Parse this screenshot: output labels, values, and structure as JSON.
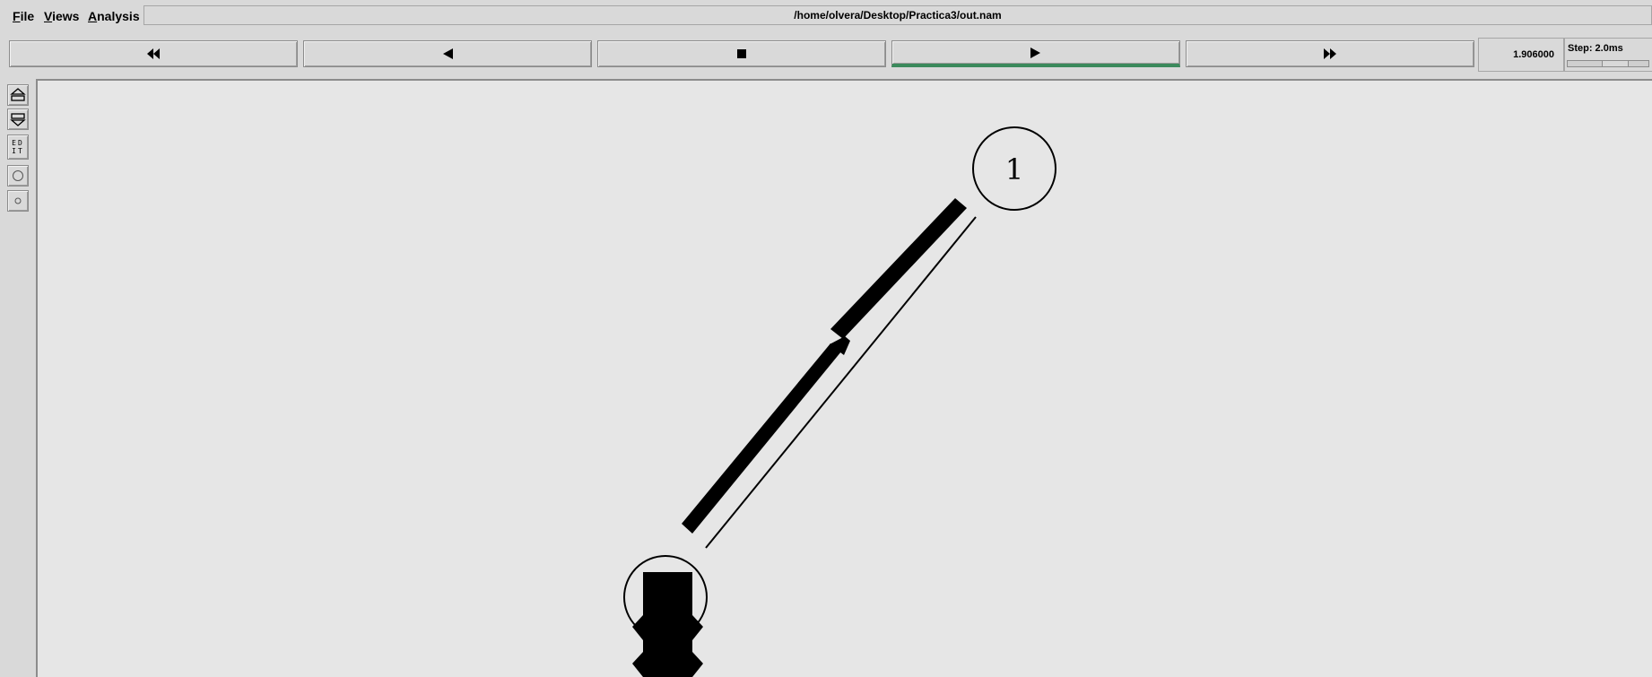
{
  "menu": {
    "file": "File",
    "views": "Views",
    "analysis": "Analysis"
  },
  "file_path": "/home/olvera/Desktop/Practica3/out.nam",
  "controls": {
    "rewind_icon": "fast-rewind-icon",
    "back_icon": "step-back-icon",
    "stop_icon": "stop-icon",
    "play_icon": "play-icon",
    "forward_icon": "fast-forward-icon",
    "active": "play"
  },
  "time_display": "1.906000",
  "step": {
    "label": "Step: 2.0ms"
  },
  "sidebar": {
    "edit_label": "EDIT",
    "zoom_in_icon": "zoom-in-icon",
    "zoom_out_icon": "zoom-out-icon",
    "node_large_icon": "circle-large-icon",
    "node_small_icon": "circle-small-icon"
  },
  "network": {
    "nodes": [
      {
        "id": "1",
        "label": "1"
      },
      {
        "id": "0",
        "label": ""
      }
    ]
  },
  "colors": {
    "background": "#d9d9d9",
    "canvas": "#e6e6e6",
    "active_indicator": "#3b8a5c"
  }
}
